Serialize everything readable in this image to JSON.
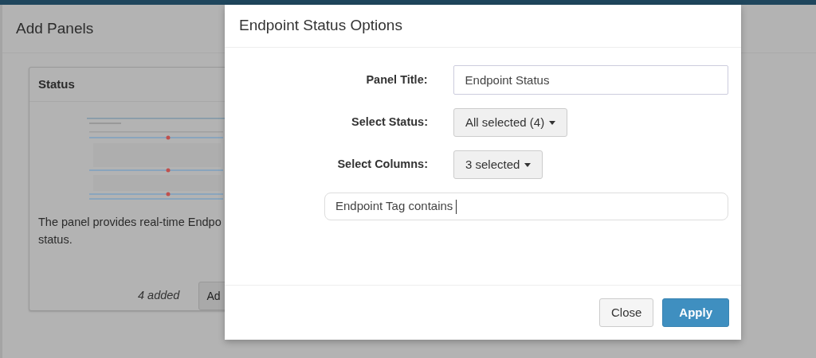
{
  "background_dialog": {
    "title": "Add Panels",
    "card": {
      "title": "Status",
      "description": [
        "The panel provides real-time Endpo",
        "status."
      ],
      "added_count": "4 added",
      "add_button": "Ad"
    }
  },
  "modal": {
    "title": "Endpoint Status Options",
    "fields": [
      {
        "kind": "text",
        "label": "Panel Title:",
        "value": "Endpoint Status"
      },
      {
        "kind": "dropdown",
        "label": "Select Status:",
        "value": "All selected (4)"
      },
      {
        "kind": "dropdown",
        "label": "Select Columns:",
        "value": "3 selected"
      },
      {
        "kind": "filter",
        "value": "Endpoint Tag contains"
      }
    ],
    "buttons": [
      {
        "label": "Close",
        "kind": "default"
      },
      {
        "label": "Apply",
        "kind": "primary"
      }
    ]
  }
}
